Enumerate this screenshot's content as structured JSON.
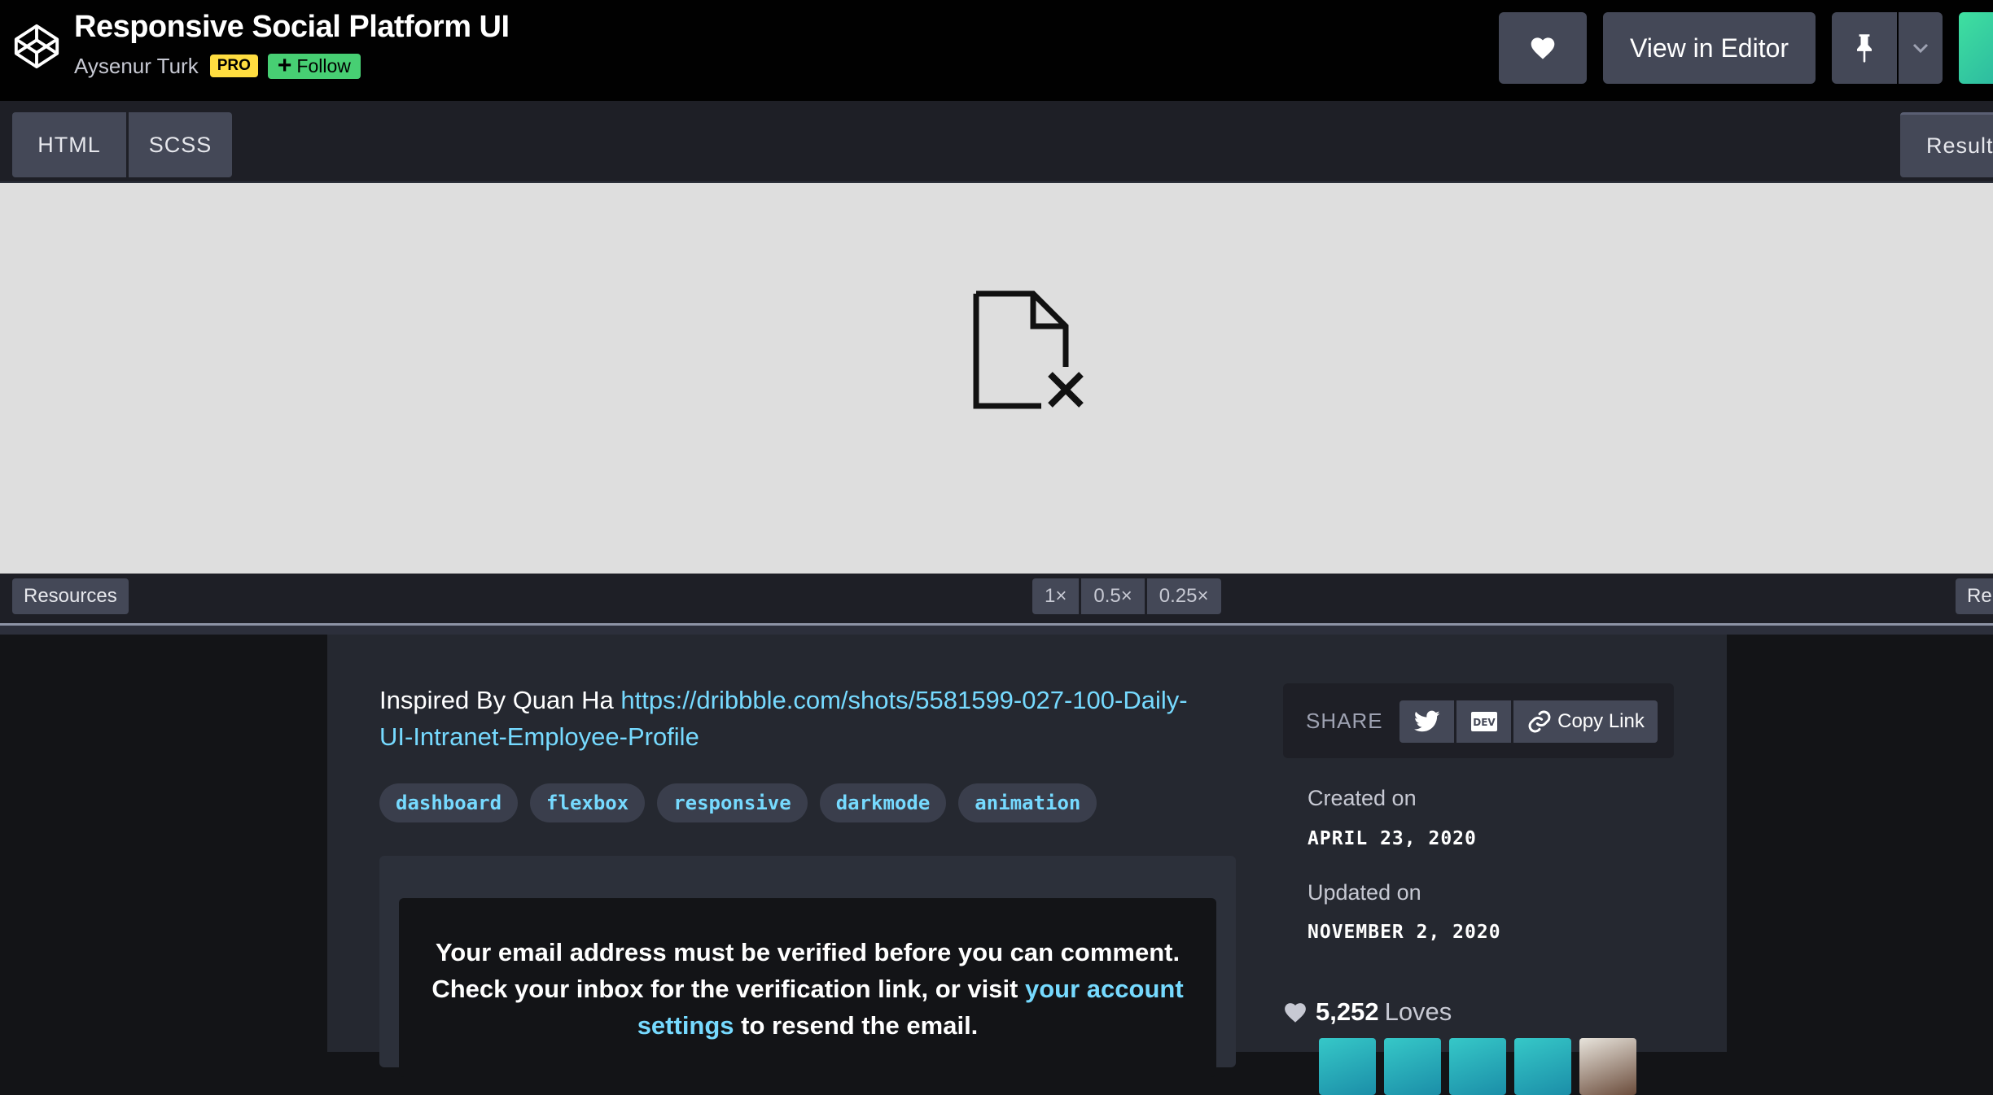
{
  "header": {
    "title": "Responsive Social Platform UI",
    "author": "Aysenur Turk",
    "pro_badge": "PRO",
    "follow_label": "Follow",
    "view_in_editor_label": "View in Editor"
  },
  "tabs": {
    "html": "HTML",
    "scss": "SCSS",
    "result": "Result"
  },
  "footbar": {
    "resources_label": "Resources",
    "zoom_options": [
      "1×",
      "0.5×",
      "0.25×"
    ],
    "rerun_label": "Rerun"
  },
  "details": {
    "description_prefix": "Inspired By Quan Ha ",
    "description_link": "https://dribbble.com/shots/5581599-027-100-Daily-UI-Intranet-Employee-Profile",
    "tags": [
      "dashboard",
      "flexbox",
      "responsive",
      "darkmode",
      "animation"
    ],
    "comment_notice_prefix": "Your email address must be verified before you can comment. Check your inbox for the verification link, or visit ",
    "comment_notice_link": "your account settings",
    "comment_notice_suffix": " to resend the email."
  },
  "sidebar": {
    "share_label": "SHARE",
    "copy_link_label": "Copy Link",
    "dev_label": "DEV",
    "created_label": "Created on",
    "created_date": "APRIL 23, 2020",
    "updated_label": "Updated on",
    "updated_date": "NOVEMBER 2, 2020",
    "loves_count": "5,252",
    "loves_word": "Loves"
  },
  "icons": {
    "logo": "codepen-logo-icon",
    "heart": "heart-icon",
    "pin": "pin-icon",
    "chevron": "chevron-down-icon",
    "broken_file": "broken-file-icon",
    "twitter": "twitter-icon",
    "dev": "dev-icon",
    "link": "link-icon"
  },
  "colors": {
    "pro_badge": "#ffdd40",
    "follow": "#47cf73",
    "link": "#76daff"
  }
}
